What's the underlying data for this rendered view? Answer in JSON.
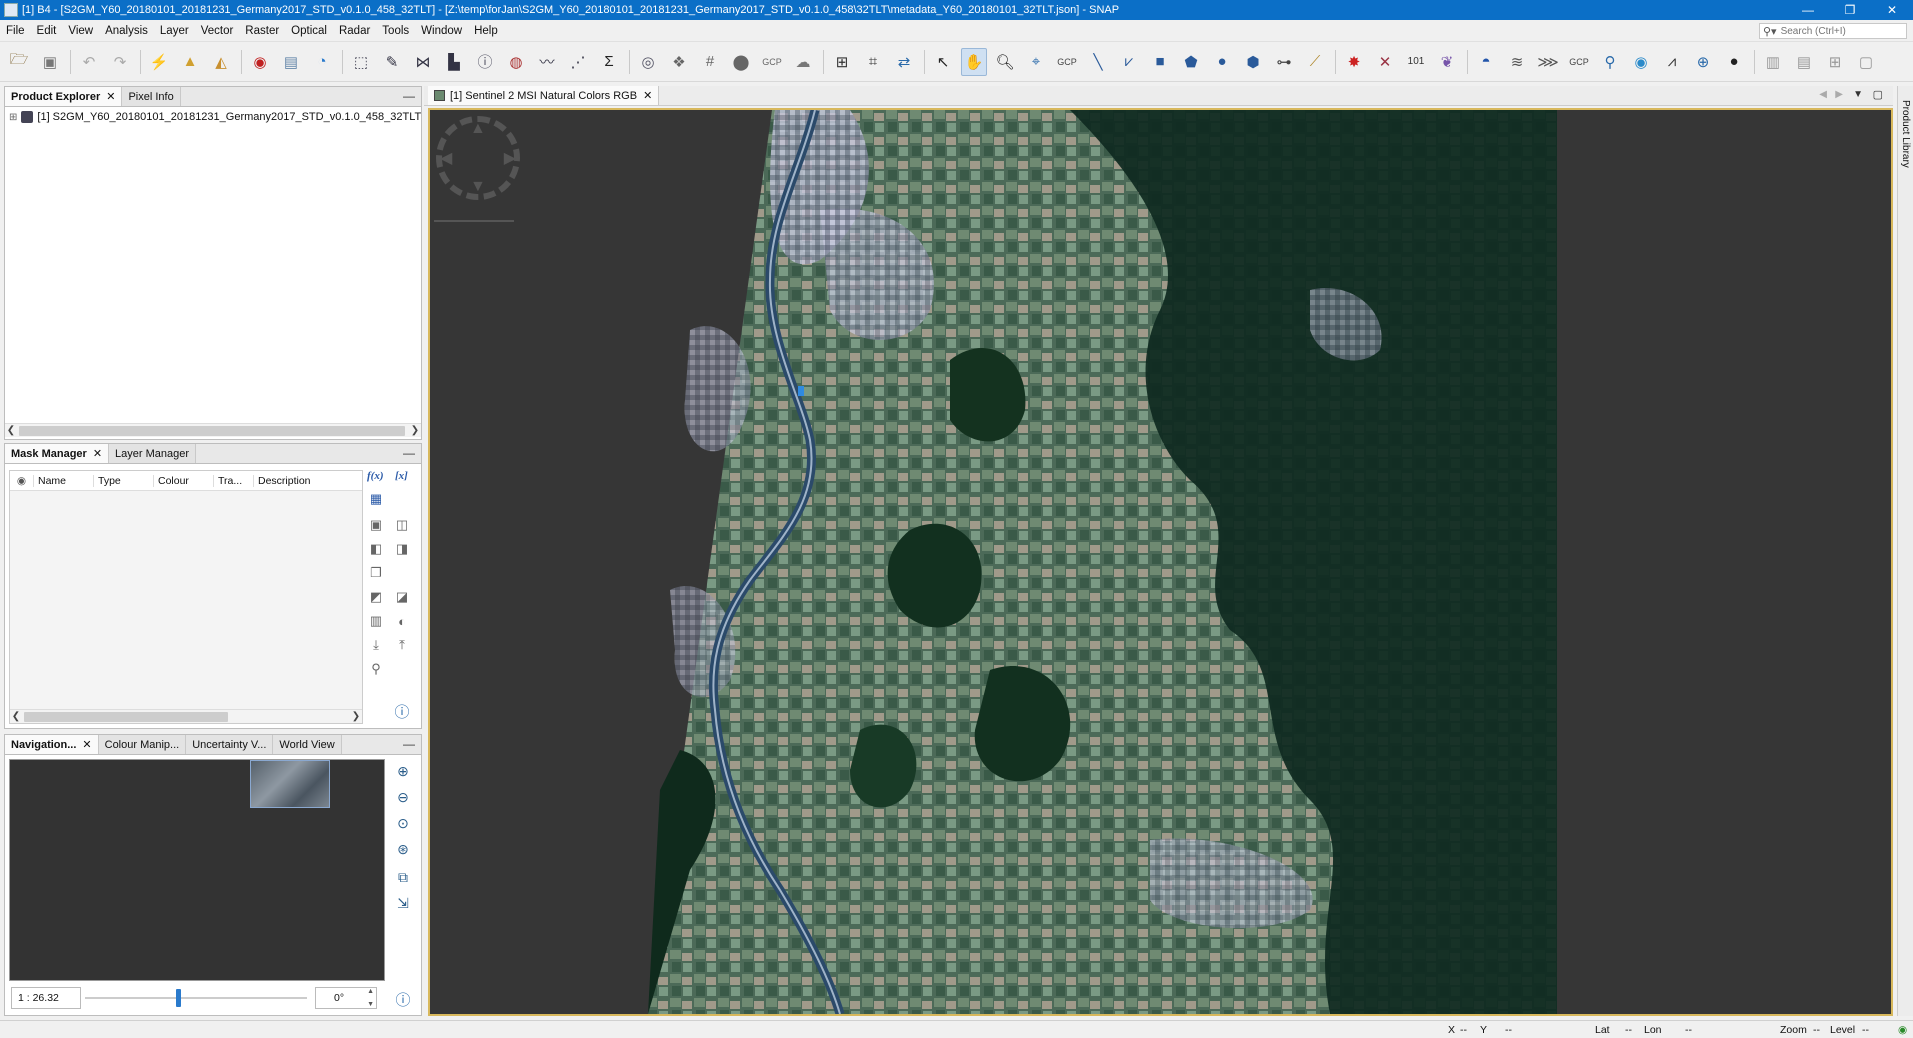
{
  "window": {
    "title": "[1] B4 - [S2GM_Y60_20180101_20181231_Germany2017_STD_v0.1.0_458_32TLT] - [Z:\\temp\\forJan\\S2GM_Y60_20180101_20181231_Germany2017_STD_v0.1.0_458\\32TLT\\metadata_Y60_20180101_32TLT.json] - SNAP",
    "minimize": "—",
    "restore": "❐",
    "close": "✕"
  },
  "menu": [
    "File",
    "Edit",
    "View",
    "Analysis",
    "Layer",
    "Vector",
    "Raster",
    "Optical",
    "Radar",
    "Tools",
    "Window",
    "Help"
  ],
  "search": {
    "placeholder": "Search (Ctrl+I)"
  },
  "toolbar": {
    "icons": [
      "open-product-icon",
      "save-product-icon",
      "undo-icon",
      "redo-icon",
      "band-maths-icon",
      "import-icon",
      "export-icon",
      "rgb-image-icon",
      "open-image-icon",
      "world-map-icon",
      "geometry-tool-icon",
      "edit-tool-icon",
      "graph-icon",
      "histogram-icon",
      "scatter-icon",
      "information-icon",
      "mask-icon",
      "profile-icon",
      "plot-icon",
      "statistics-icon",
      "sum-icon",
      "globe-icon",
      "layer-icon",
      "grid-icon",
      "node-icon",
      "gcp-icon",
      "cloud-icon",
      "network-icon",
      "classify-icon",
      "pin-icon",
      "select-tool-icon",
      "pan-tool-icon",
      "zoom-tool-icon",
      "zoom-pin-icon",
      "gcp-tool-icon",
      "line-tool-icon",
      "polyline-tool-icon",
      "rectangle-tool-icon",
      "polygon-tool-icon",
      "ellipse-tool-icon",
      "drawing-tool-icon",
      "range-finder-icon",
      "magic-wand-icon",
      "star-icon",
      "cross-icon",
      "binary-icon",
      "cluster-icon",
      "terrain-icon",
      "flow-icon",
      "radar-icon",
      "gcp-manager-icon",
      "eye-pick-icon",
      "eye-icon",
      "chart-icon",
      "globe2-icon",
      "sphere-icon",
      "tile-vertical-icon",
      "tile-horizontal-icon",
      "tile-grid-icon",
      "tile-single-icon"
    ]
  },
  "product_explorer": {
    "tabs": [
      "Product Explorer",
      "Pixel Info"
    ],
    "product": "[1] S2GM_Y60_20180101_20181231_Germany2017_STD_v0.1.0_458_32TLT"
  },
  "mask_manager": {
    "tabs": [
      "Mask Manager",
      "Layer Manager"
    ],
    "columns": [
      "Name",
      "Type",
      "Colour",
      "Tra...",
      "Description"
    ],
    "fx_label": "f(x)",
    "var_label": "[x]"
  },
  "navigation": {
    "tabs": [
      "Navigation...",
      "Colour Manip...",
      "Uncertainty V...",
      "World View"
    ],
    "scale": "1 : 26.32",
    "angle": "0°",
    "zoom_level": 0.42
  },
  "image_view": {
    "tab": "[1] Sentinel 2 MSI Natural Colors RGB"
  },
  "side_panel": {
    "label": "Product Library"
  },
  "status": {
    "x_label": "X",
    "x_value": "--",
    "y_label": "Y",
    "y_value": "--",
    "lat_label": "Lat",
    "lat_value": "--",
    "lon_label": "Lon",
    "lon_value": "--",
    "zoom_label": "Zoom",
    "zoom_value": "--",
    "level_label": "Level",
    "level_value": "--"
  },
  "colors": {
    "titlebar": "#0b6fc7",
    "view_border": "#d8b85c",
    "view_bg": "#363636",
    "forest": "#0f2a20",
    "river": "#2b4a6a"
  }
}
